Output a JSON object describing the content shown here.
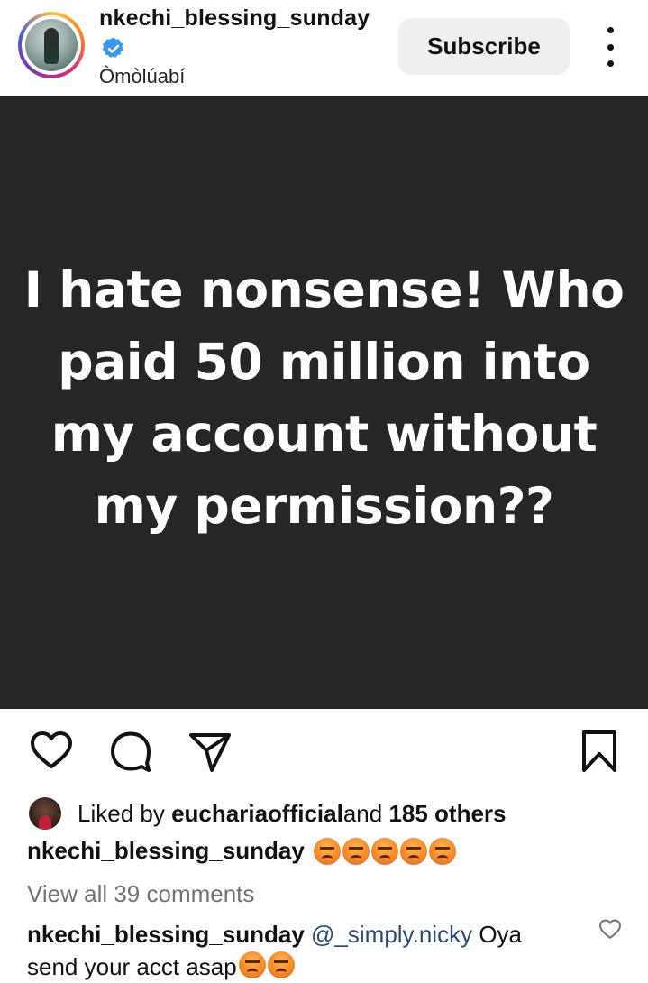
{
  "header": {
    "username": "nkechi_blessing_sunday",
    "subtitle": "Òmòlúabí",
    "subscribe_label": "Subscribe"
  },
  "post": {
    "image_text": "I hate nonsense! Who paid 50 million into my account without my permission??"
  },
  "likes": {
    "prefix": "Liked by ",
    "user": "euchariaofficial",
    "middle": " and ",
    "others": "185 others"
  },
  "caption": {
    "username": "nkechi_blessing_sunday",
    "emoji_count": 5
  },
  "view_comments_label": "View all 39 comments",
  "comment": {
    "username": "nkechi_blessing_sunday",
    "mention": "@_simply.nicky",
    "text": " Oya send your acct asap",
    "emoji_count": 2
  },
  "colors": {
    "post_background": "#262626",
    "verified_badge": "#3897f0",
    "mention_link": "#2b4a7a"
  }
}
